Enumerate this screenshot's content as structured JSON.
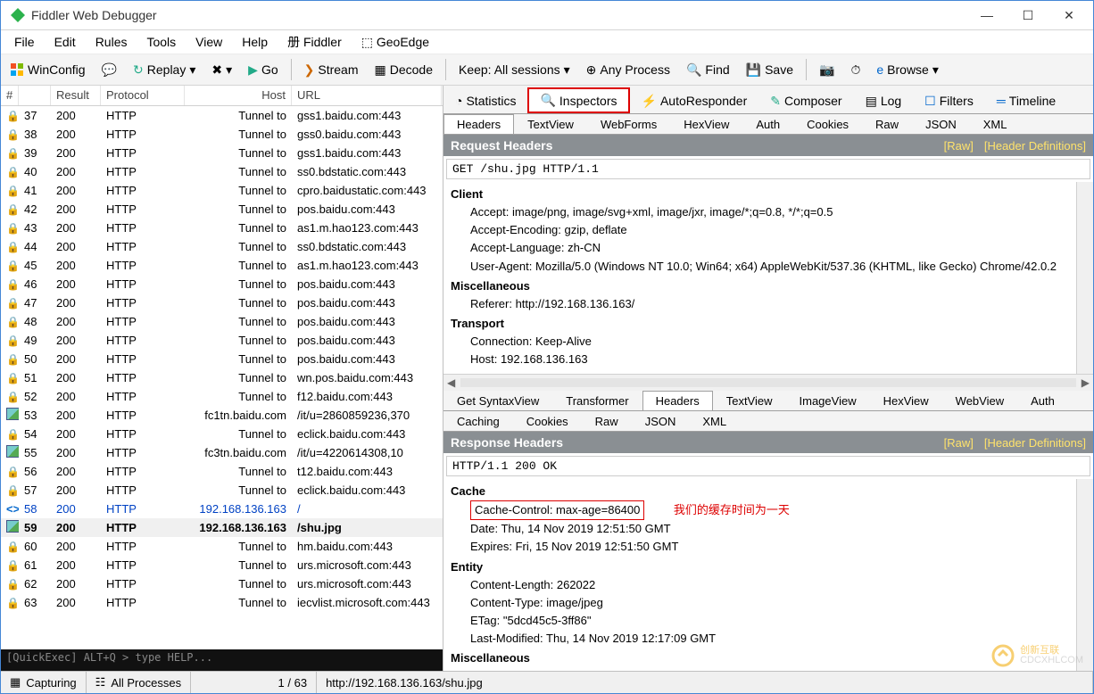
{
  "title": "Fiddler Web Debugger",
  "menu": [
    "File",
    "Edit",
    "Rules",
    "Tools",
    "View",
    "Help",
    "册 Fiddler",
    "GeoEdge"
  ],
  "toolbar": {
    "winconfig": "WinConfig",
    "replay": "Replay",
    "go": "Go",
    "stream": "Stream",
    "decode": "Decode",
    "keep": "Keep: All sessions",
    "anyproc": "Any Process",
    "find": "Find",
    "save": "Save",
    "browse": "Browse"
  },
  "grid": {
    "columns": [
      "#",
      "Result",
      "Protocol",
      "Host",
      "URL"
    ],
    "rows": [
      {
        "n": "37",
        "r": "200",
        "p": "HTTP",
        "h": "Tunnel to",
        "u": "gss1.baidu.com:443",
        "ico": "lock"
      },
      {
        "n": "38",
        "r": "200",
        "p": "HTTP",
        "h": "Tunnel to",
        "u": "gss0.baidu.com:443",
        "ico": "lock"
      },
      {
        "n": "39",
        "r": "200",
        "p": "HTTP",
        "h": "Tunnel to",
        "u": "gss1.baidu.com:443",
        "ico": "lock"
      },
      {
        "n": "40",
        "r": "200",
        "p": "HTTP",
        "h": "Tunnel to",
        "u": "ss0.bdstatic.com:443",
        "ico": "lock"
      },
      {
        "n": "41",
        "r": "200",
        "p": "HTTP",
        "h": "Tunnel to",
        "u": "cpro.baidustatic.com:443",
        "ico": "lock"
      },
      {
        "n": "42",
        "r": "200",
        "p": "HTTP",
        "h": "Tunnel to",
        "u": "pos.baidu.com:443",
        "ico": "lock"
      },
      {
        "n": "43",
        "r": "200",
        "p": "HTTP",
        "h": "Tunnel to",
        "u": "as1.m.hao123.com:443",
        "ico": "lock"
      },
      {
        "n": "44",
        "r": "200",
        "p": "HTTP",
        "h": "Tunnel to",
        "u": "ss0.bdstatic.com:443",
        "ico": "lock"
      },
      {
        "n": "45",
        "r": "200",
        "p": "HTTP",
        "h": "Tunnel to",
        "u": "as1.m.hao123.com:443",
        "ico": "lock"
      },
      {
        "n": "46",
        "r": "200",
        "p": "HTTP",
        "h": "Tunnel to",
        "u": "pos.baidu.com:443",
        "ico": "lock"
      },
      {
        "n": "47",
        "r": "200",
        "p": "HTTP",
        "h": "Tunnel to",
        "u": "pos.baidu.com:443",
        "ico": "lock"
      },
      {
        "n": "48",
        "r": "200",
        "p": "HTTP",
        "h": "Tunnel to",
        "u": "pos.baidu.com:443",
        "ico": "lock"
      },
      {
        "n": "49",
        "r": "200",
        "p": "HTTP",
        "h": "Tunnel to",
        "u": "pos.baidu.com:443",
        "ico": "lock"
      },
      {
        "n": "50",
        "r": "200",
        "p": "HTTP",
        "h": "Tunnel to",
        "u": "pos.baidu.com:443",
        "ico": "lock"
      },
      {
        "n": "51",
        "r": "200",
        "p": "HTTP",
        "h": "Tunnel to",
        "u": "wn.pos.baidu.com:443",
        "ico": "lock"
      },
      {
        "n": "52",
        "r": "200",
        "p": "HTTP",
        "h": "Tunnel to",
        "u": "f12.baidu.com:443",
        "ico": "lock"
      },
      {
        "n": "53",
        "r": "200",
        "p": "HTTP",
        "h": "fc1tn.baidu.com",
        "u": "/it/u=2860859236,370",
        "ico": "img"
      },
      {
        "n": "54",
        "r": "200",
        "p": "HTTP",
        "h": "Tunnel to",
        "u": "eclick.baidu.com:443",
        "ico": "lock"
      },
      {
        "n": "55",
        "r": "200",
        "p": "HTTP",
        "h": "fc3tn.baidu.com",
        "u": "/it/u=4220614308,10",
        "ico": "img"
      },
      {
        "n": "56",
        "r": "200",
        "p": "HTTP",
        "h": "Tunnel to",
        "u": "t12.baidu.com:443",
        "ico": "lock"
      },
      {
        "n": "57",
        "r": "200",
        "p": "HTTP",
        "h": "Tunnel to",
        "u": "eclick.baidu.com:443",
        "ico": "lock"
      },
      {
        "n": "58",
        "r": "200",
        "p": "HTTP",
        "h": "192.168.136.163",
        "u": "/",
        "ico": "arrows",
        "hl": true
      },
      {
        "n": "59",
        "r": "200",
        "p": "HTTP",
        "h": "192.168.136.163",
        "u": "/shu.jpg",
        "ico": "img",
        "sel": true
      },
      {
        "n": "60",
        "r": "200",
        "p": "HTTP",
        "h": "Tunnel to",
        "u": "hm.baidu.com:443",
        "ico": "lock"
      },
      {
        "n": "61",
        "r": "200",
        "p": "HTTP",
        "h": "Tunnel to",
        "u": "urs.microsoft.com:443",
        "ico": "lock"
      },
      {
        "n": "62",
        "r": "200",
        "p": "HTTP",
        "h": "Tunnel to",
        "u": "urs.microsoft.com:443",
        "ico": "lock"
      },
      {
        "n": "63",
        "r": "200",
        "p": "HTTP",
        "h": "Tunnel to",
        "u": "iecvlist.microsoft.com:443",
        "ico": "lock"
      }
    ]
  },
  "quickexec": "[QuickExec] ALT+Q > type HELP...",
  "status": {
    "capturing": "Capturing",
    "allproc": "All Processes",
    "count": "1 / 63",
    "url": "http://192.168.136.163/shu.jpg"
  },
  "rightTabs": {
    "stats": "Statistics",
    "inspectors": "Inspectors",
    "autoresp": "AutoResponder",
    "composer": "Composer",
    "log": "Log",
    "filters": "Filters",
    "timeline": "Timeline"
  },
  "reqTabs": [
    "Headers",
    "TextView",
    "WebForms",
    "HexView",
    "Auth",
    "Cookies",
    "Raw",
    "JSON",
    "XML"
  ],
  "reqBar": {
    "title": "Request Headers",
    "raw": "[Raw]",
    "def": "[Header Definitions]"
  },
  "reqLine": "GET /shu.jpg HTTP/1.1",
  "reqHdrs": {
    "Client": [
      "Accept: image/png, image/svg+xml, image/jxr, image/*;q=0.8, */*;q=0.5",
      "Accept-Encoding: gzip, deflate",
      "Accept-Language: zh-CN",
      "User-Agent: Mozilla/5.0 (Windows NT 10.0; Win64; x64) AppleWebKit/537.36 (KHTML, like Gecko) Chrome/42.0.2"
    ],
    "Miscellaneous": [
      "Referer: http://192.168.136.163/"
    ],
    "Transport": [
      "Connection: Keep-Alive",
      "Host: 192.168.136.163"
    ]
  },
  "respTabs": [
    "Get SyntaxView",
    "Transformer",
    "Headers",
    "TextView",
    "ImageView",
    "HexView",
    "WebView",
    "Auth"
  ],
  "respTabs2": [
    "Caching",
    "Cookies",
    "Raw",
    "JSON",
    "XML"
  ],
  "respBar": {
    "title": "Response Headers",
    "raw": "[Raw]",
    "def": "[Header Definitions]"
  },
  "respLine": "HTTP/1.1 200 OK",
  "respHdrs": {
    "Cache": [
      {
        "t": "Cache-Control: max-age=86400",
        "box": true
      },
      {
        "t": "Date: Thu, 14 Nov 2019 12:51:50 GMT"
      },
      {
        "t": "Expires: Fri, 15 Nov 2019 12:51:50 GMT"
      }
    ],
    "Entity": [
      {
        "t": "Content-Length: 262022"
      },
      {
        "t": "Content-Type: image/jpeg"
      },
      {
        "t": "ETag: \"5dcd45c5-3ff86\""
      },
      {
        "t": "Last-Modified: Thu, 14 Nov 2019 12:17:09 GMT"
      }
    ],
    "Miscellaneous": []
  },
  "annotation": "我们的缓存时间为一天",
  "watermark": {
    "brand": "创新互联",
    "sub": "CDCXHLCOM"
  }
}
